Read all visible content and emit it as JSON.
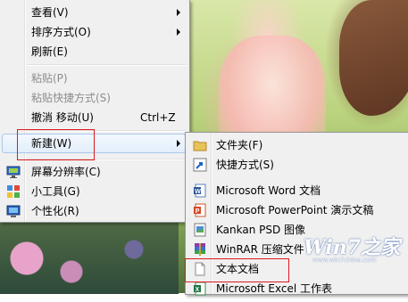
{
  "context_menu": {
    "items": [
      {
        "label": "查看(V)",
        "arrow": true
      },
      {
        "label": "排序方式(O)",
        "arrow": true
      },
      {
        "label": "刷新(E)"
      },
      {
        "label": "粘贴(P)",
        "disabled": true
      },
      {
        "label": "粘贴快捷方式(S)",
        "disabled": true
      },
      {
        "label": "撤消 移动(U)",
        "shortcut": "Ctrl+Z"
      },
      {
        "label": "新建(W)",
        "arrow": true,
        "highlighted": true
      },
      {
        "label": "屏幕分辨率(C)",
        "icon": "monitor-icon"
      },
      {
        "label": "小工具(G)",
        "icon": "gadgets-icon"
      },
      {
        "label": "个性化(R)",
        "icon": "personalize-icon"
      }
    ]
  },
  "new_submenu": {
    "items": [
      {
        "label": "文件夹(F)",
        "icon": "folder-icon"
      },
      {
        "label": "快捷方式(S)",
        "icon": "shortcut-icon"
      },
      {
        "label": "Microsoft Word 文档",
        "icon": "word-document-icon"
      },
      {
        "label": "Microsoft PowerPoint 演示文稿",
        "icon": "powerpoint-icon"
      },
      {
        "label": "Kankan PSD 图像",
        "icon": "psd-image-icon"
      },
      {
        "label": "WinRAR 压缩文件",
        "icon": "winrar-icon"
      },
      {
        "label": "文本文档",
        "icon": "text-document-icon"
      },
      {
        "label": "Microsoft Excel 工作表",
        "icon": "excel-icon"
      }
    ]
  },
  "watermark": {
    "text": "Win7之家",
    "url": "www.win7china.com"
  },
  "colors": {
    "highlight_border": "#a8c8ec",
    "annotation_red": "#e0191b",
    "menu_bg": "#f0f0f0"
  }
}
